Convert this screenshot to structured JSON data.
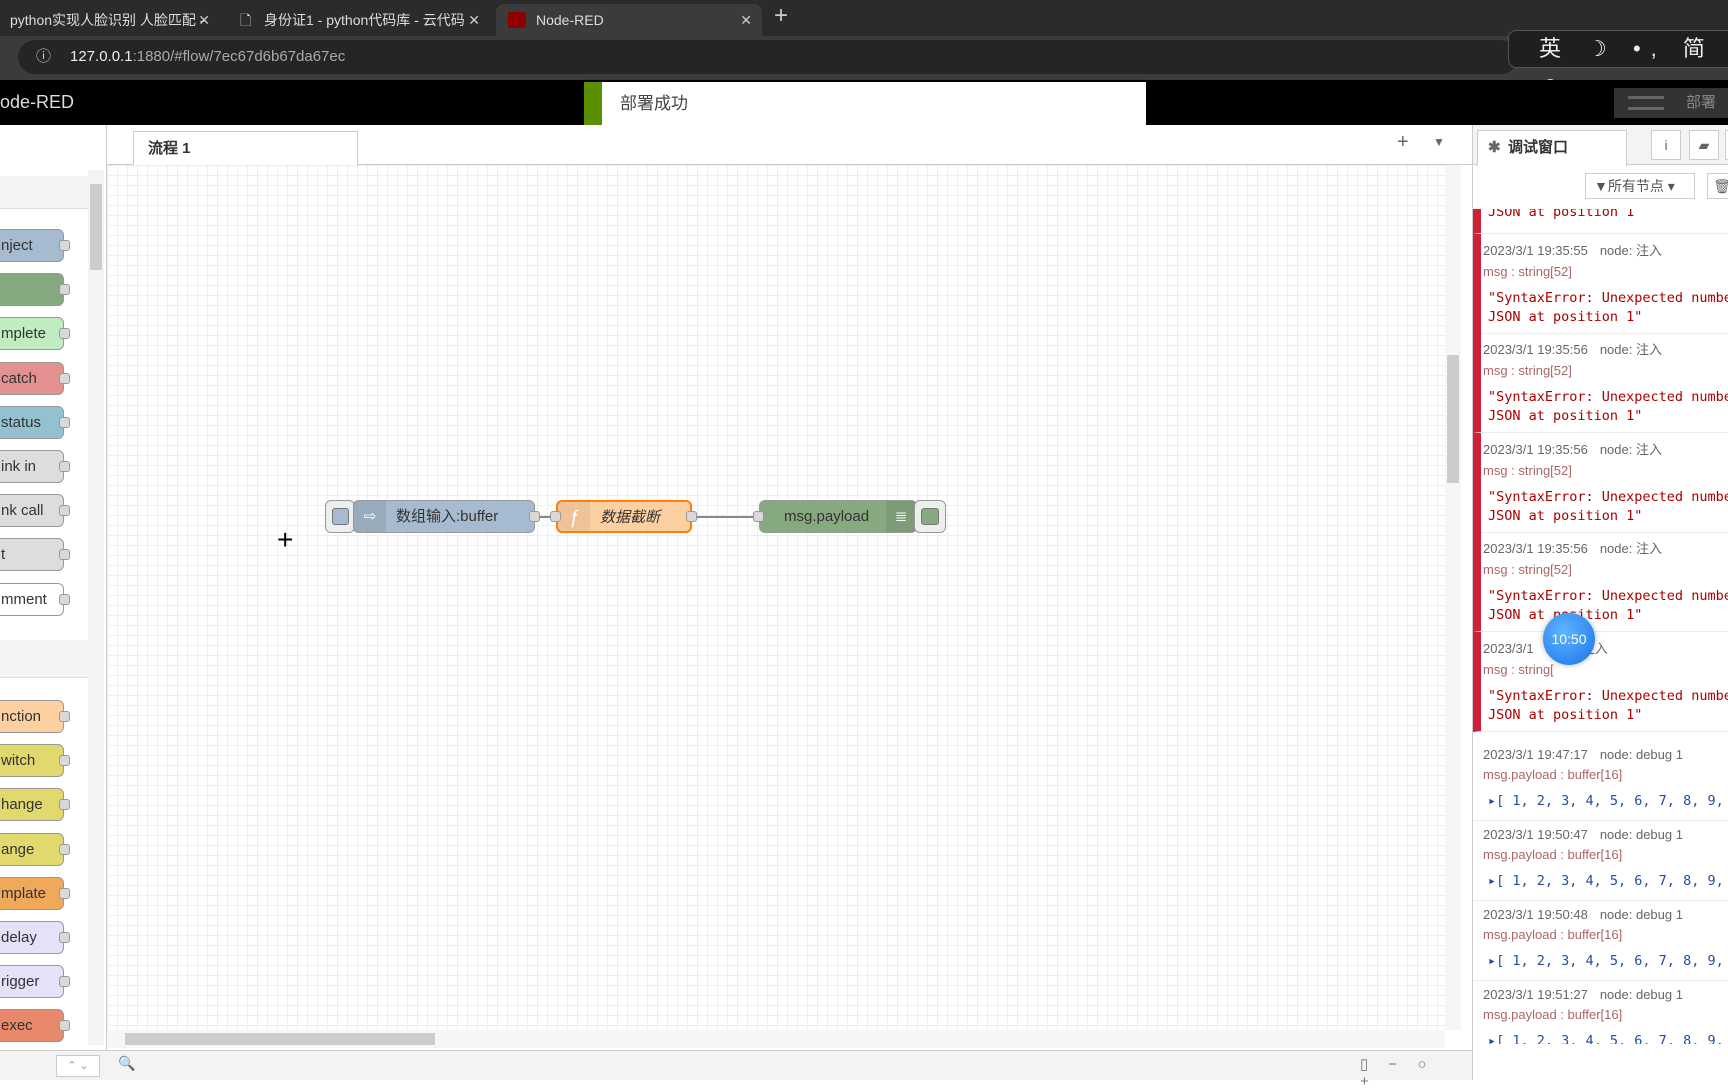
{
  "browser": {
    "tabs": [
      {
        "title": "python实现人脸识别 人脸匹配 -"
      },
      {
        "title": "身份证1 - python代码库 - 云代码"
      },
      {
        "title": "Node-RED"
      }
    ],
    "url_host": "127.0.0.1",
    "url_rest": ":1880/#flow/7ec67d6b67da67ec",
    "ime": "英 ☽ •, 简 ☺"
  },
  "header": {
    "title": "ode-RED",
    "deploy_label": "部署",
    "toast": "部署成功"
  },
  "palette": {
    "nodes1": [
      {
        "label": "nject",
        "color": "#a6bbcf"
      },
      {
        "label": "",
        "color": "#87a980"
      },
      {
        "label": "mplete",
        "color": "#c0edc0"
      },
      {
        "label": "catch",
        "color": "#e49191"
      },
      {
        "label": "status",
        "color": "#94c1d0"
      },
      {
        "label": "ink in",
        "color": "#dddddd"
      },
      {
        "label": "nk call",
        "color": "#dddddd"
      },
      {
        "label": "t",
        "color": "#dddddd"
      },
      {
        "label": "mment",
        "color": "#ffffff"
      }
    ],
    "nodes2": [
      {
        "label": "nction",
        "color": "#fdd0a2"
      },
      {
        "label": "witch",
        "color": "#e2d96e"
      },
      {
        "label": "hange",
        "color": "#e2d96e"
      },
      {
        "label": "ange",
        "color": "#e2d96e"
      },
      {
        "label": "mplate",
        "color": "#f0a95b"
      },
      {
        "label": "delay",
        "color": "#e6e0f8"
      },
      {
        "label": "rigger",
        "color": "#e6e0f8"
      },
      {
        "label": "exec",
        "color": "#e9896c"
      }
    ]
  },
  "workspace": {
    "tab": "流程 1",
    "nodes": {
      "inject": "数组输入:buffer",
      "function": "数据截断",
      "debug": "msg.payload"
    }
  },
  "sidebar": {
    "tab": "调试窗口",
    "filter": "所有节点",
    "top_partial": "JSON at position 1",
    "messages": [
      {
        "time": "2023/3/1 19:35:55",
        "node": "node: 注入",
        "type": "msg : string[52]",
        "value": "\"SyntaxError: Unexpected numbe\nJSON at position 1\"",
        "err": true
      },
      {
        "time": "2023/3/1 19:35:56",
        "node": "node: 注入",
        "type": "msg : string[52]",
        "value": "\"SyntaxError: Unexpected numbe\nJSON at position 1\"",
        "err": true
      },
      {
        "time": "2023/3/1 19:35:56",
        "node": "node: 注入",
        "type": "msg : string[52]",
        "value": "\"SyntaxError: Unexpected numbe\nJSON at position 1\"",
        "err": true
      },
      {
        "time": "2023/3/1 19:35:56",
        "node": "node: 注入",
        "type": "msg : string[52]",
        "value": "\"SyntaxError: Unexpected numbe\nJSON at position 1\"",
        "err": true
      },
      {
        "time": "2023/3/1",
        "node": "node: 注入",
        "type": "msg : string[",
        "value": "\"SyntaxError: Unexpected numbe\nJSON at position 1\"",
        "err": true
      },
      {
        "time": "2023/3/1 19:47:17",
        "node": "node: debug 1",
        "type": "msg.payload : buffer[16]",
        "value": "▸[ 1, 2, 3, 4, 5, 6, 7, 8, 9,",
        "err": false
      },
      {
        "time": "2023/3/1 19:50:47",
        "node": "node: debug 1",
        "type": "msg.payload : buffer[16]",
        "value": "▸[ 1, 2, 3, 4, 5, 6, 7, 8, 9,",
        "err": false
      },
      {
        "time": "2023/3/1 19:50:48",
        "node": "node: debug 1",
        "type": "msg.payload : buffer[16]",
        "value": "▸[ 1, 2, 3, 4, 5, 6, 7, 8, 9,",
        "err": false
      },
      {
        "time": "2023/3/1 19:51:27",
        "node": "node: debug 1",
        "type": "msg.payload : buffer[16]",
        "value": "▸[ 1, 2, 3, 4, 5, 6, 7, 8, 9,",
        "err": false
      }
    ]
  },
  "overlay": {
    "clock": "10:50"
  }
}
